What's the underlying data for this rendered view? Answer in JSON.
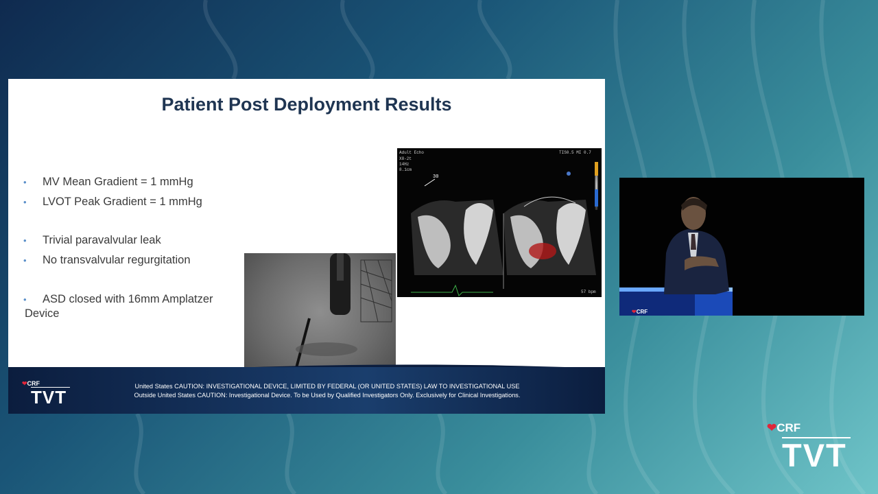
{
  "slide": {
    "title": "Patient Post Deployment Results",
    "bullets": [
      {
        "text": "MV Mean Gradient = 1 mmHg"
      },
      {
        "text": "LVOT Peak Gradient = 1 mmHg"
      },
      {
        "text": "Trivial paravalvular leak"
      },
      {
        "text": "No transvalvular regurgitation"
      },
      {
        "text": "ASD closed with 16mm Amplatzer",
        "text2": "Device"
      }
    ],
    "echo": {
      "header_left": "Adult Echo",
      "probe": "X8-2t",
      "freq": "14Hz",
      "depth": "8.1cm",
      "ti_mi": "TIS0.5   MI 0.7",
      "angle": "30",
      "bpm": "57 bpm"
    },
    "footer": {
      "line1": "United States CAUTION: INVESTIGATIONAL DEVICE, LIMITED BY FEDERAL (OR UNITED STATES) LAW TO INVESTIGATIONAL USE",
      "line2": "Outside United States CAUTION: Investigational Device. To be Used by Qualified Investigators Only. Exclusively for Clinical Investigations."
    },
    "logo": {
      "crf": "CRF",
      "tvt": "TVT"
    }
  },
  "corner_logo": {
    "crf": "CRF",
    "tvt": "TVT"
  },
  "video": {
    "podium_logo": "CRF"
  }
}
